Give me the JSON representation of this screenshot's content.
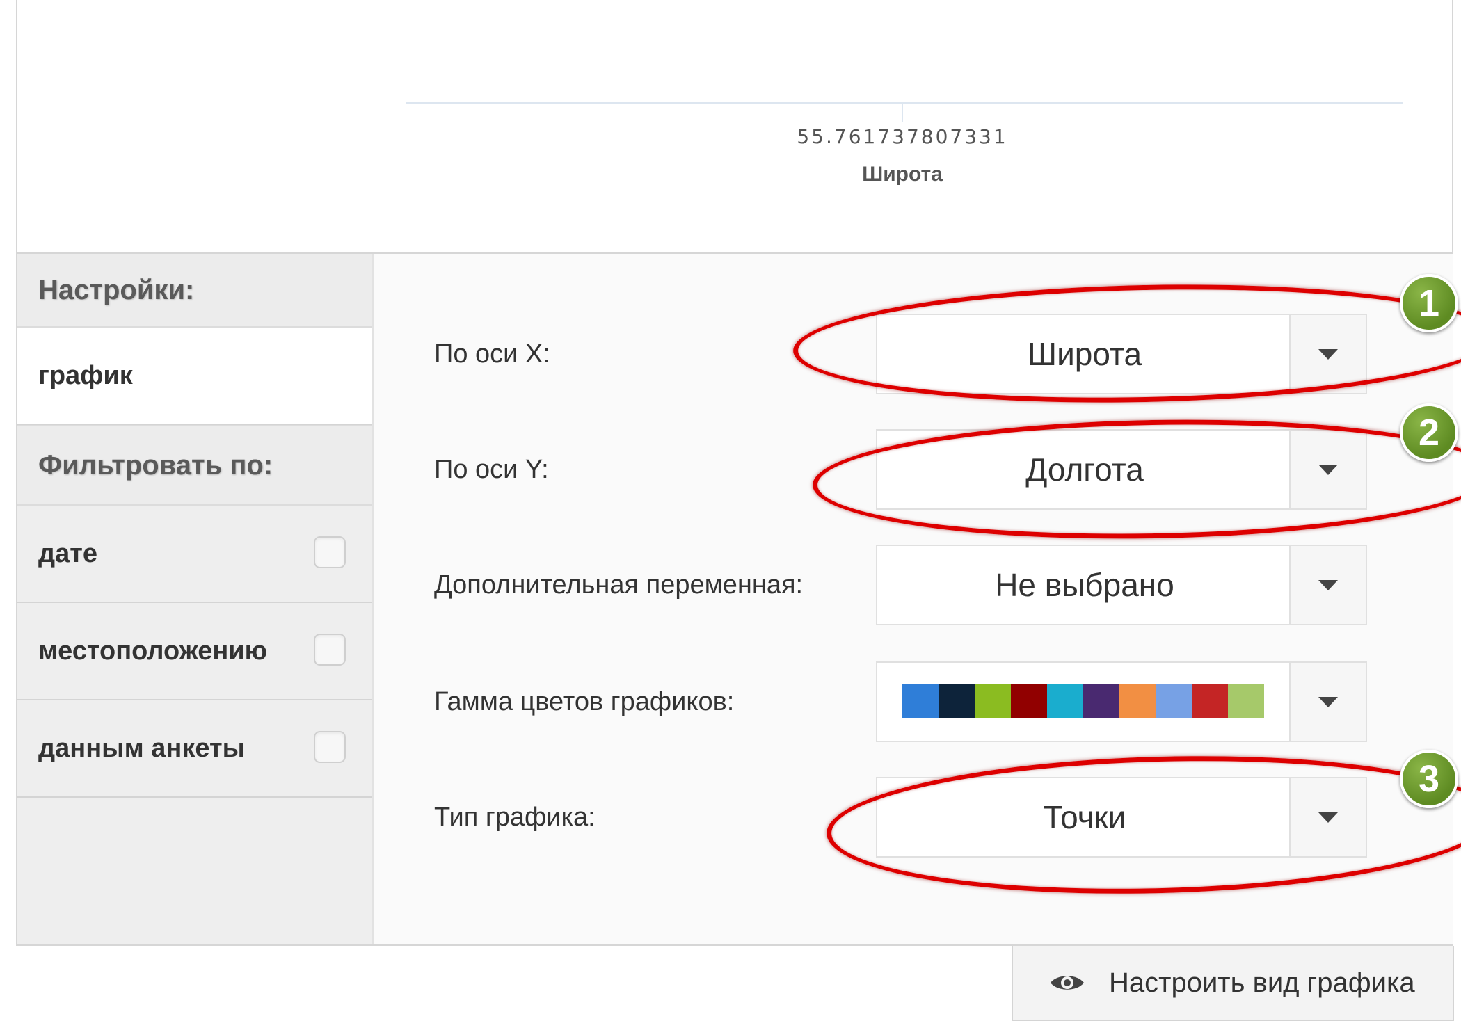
{
  "chart": {
    "x_tick_label": "55.761737807331",
    "x_axis_title": "Широта"
  },
  "sidebar": {
    "settings_header": "Настройки:",
    "chart_item": "график",
    "filter_header": "Фильтровать по:",
    "filters": [
      {
        "label": "дате",
        "checked": false
      },
      {
        "label": "местоположению",
        "checked": false
      },
      {
        "label": "данным анкеты",
        "checked": false
      }
    ]
  },
  "form": {
    "x_axis": {
      "label": "По оси X:",
      "value": "Широта"
    },
    "y_axis": {
      "label": "По оси Y:",
      "value": "Долгота"
    },
    "extra_var": {
      "label": "Дополнительная переменная:",
      "value": "Не выбрано"
    },
    "palette": {
      "label": "Гамма цветов графиков:",
      "colors": [
        "#2f7ed8",
        "#0d233a",
        "#8bbc21",
        "#910000",
        "#1aadce",
        "#492970",
        "#f28f43",
        "#77a1e5",
        "#c42525",
        "#a6c96a"
      ]
    },
    "chart_type": {
      "label": "Тип графика:",
      "value": "Точки"
    }
  },
  "annotations": [
    "1",
    "2",
    "3"
  ],
  "customize_button": {
    "label": "Настроить вид графика",
    "icon": "eye-icon"
  },
  "colors": {
    "annotation_red": "#dd0000",
    "badge_green": "#6a9a2c"
  }
}
